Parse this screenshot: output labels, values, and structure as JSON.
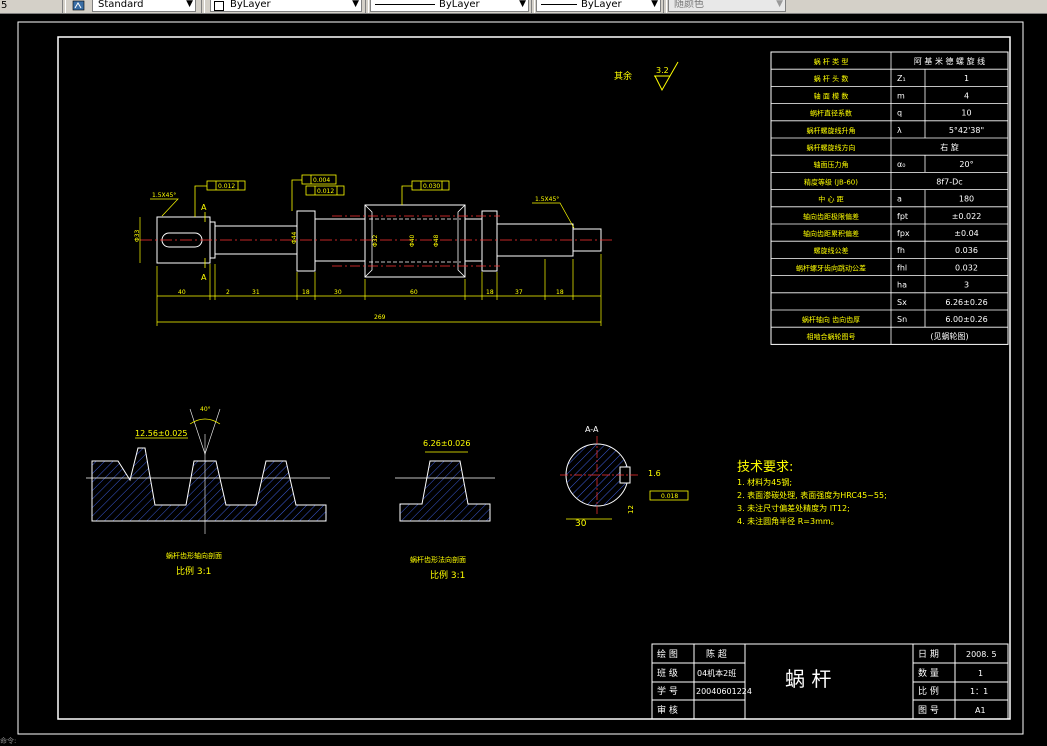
{
  "toolbar": {
    "left_value": "5",
    "text_style": "Standard",
    "layer": "ByLayer",
    "linetype": "ByLayer",
    "lineweight": "ByLayer",
    "color": "随颜色"
  },
  "title_block": {
    "part_name": "蜗   杆",
    "drawn_label": "绘  图",
    "drawn_value": "陈  超",
    "class_label": "班  级",
    "class_value": "04机本2班",
    "student_label": "学  号",
    "student_value": "20040601224",
    "review_label": "审  核",
    "date_label": "日  期",
    "date_value": "2008. 5",
    "qty_label": "数  量",
    "qty_value": "1",
    "scale_label": "比  例",
    "scale_value": "1：1",
    "drawing_no_label": "图  号",
    "drawing_no_value": "A1"
  },
  "param_table": {
    "rows": [
      {
        "label": "蜗  杆  类  型",
        "sym": "",
        "value": "阿  基  米  德  螺  旋  线"
      },
      {
        "label": "蜗  杆  头  数",
        "sym": "Z₁",
        "value": "1"
      },
      {
        "label": "轴  面  模  数",
        "sym": "m",
        "value": "4"
      },
      {
        "label": "蜗杆直径系数",
        "sym": "q",
        "value": "10"
      },
      {
        "label": "蜗杆螺旋线升角",
        "sym": "λ",
        "value": "5°42'38\""
      },
      {
        "label": "蜗杆螺旋线方向",
        "sym": "",
        "value": "右    旋"
      },
      {
        "label": "轴面压力角",
        "sym": "α₀",
        "value": "20°"
      },
      {
        "label": "精度等级  (JB-60)",
        "sym": "",
        "value": "8f7-Dc"
      },
      {
        "label": "中  心  距",
        "sym": "a",
        "value": "180"
      },
      {
        "label": "轴向齿距极限偏差",
        "sym": "fpt",
        "value": "±0.022"
      },
      {
        "label": "轴向齿距累积偏差",
        "sym": "fpx",
        "value": "±0.04"
      },
      {
        "label": "螺旋线公差",
        "sym": "fh",
        "value": "0.036"
      },
      {
        "label": "蜗杆螺牙齿向跳动公差",
        "sym": "fhl",
        "value": "0.032"
      },
      {
        "label": "",
        "sym": "ha",
        "value": "3"
      },
      {
        "label": "",
        "sym": "Sx",
        "value": "6.26±0.26"
      },
      {
        "label": "蜗杆轴向  齿向齿厚",
        "sym": "Sn",
        "value": "6.00±0.26"
      },
      {
        "label": "相啮合蜗轮图号",
        "sym": "",
        "value": "(见蜗轮图)"
      }
    ]
  },
  "notes": {
    "title": "技术要求:",
    "items": [
      "1. 材料为45钢;",
      "2. 表面渗碳处理, 表面强度为HRC45~55;",
      "3. 未注尺寸偏差处精度为 IT12;",
      "4. 未注圆角半径 R=3mm。"
    ]
  },
  "labels": {
    "roughness_note": "其余",
    "roughness_value": "3.2",
    "view1_title": "蜗杆齿形轴向剖面",
    "view1_scale": "比例  3:1",
    "view2_title": "蜗杆齿形法向剖面",
    "view2_scale": "比例  3:1",
    "section_label": "A-A",
    "tol1": "0.012",
    "tol2": "0.004",
    "tol3": "0.012",
    "tol4": "0.030",
    "tol5": "0.018",
    "chamfer_left": "1.5X45°",
    "chamfer_right": "1.5X45°",
    "dim_total": "269",
    "dim_40": "40",
    "dim_2": "2",
    "dim_31": "31",
    "dim_18a": "18",
    "dim_30": "30",
    "dim_60": "60",
    "dim_18b": "18",
    "dim_37": "37",
    "dim_18c": "18",
    "dim_12_56": "12.56±0.025",
    "dim_6_26": "6.26±0.026",
    "dim_40deg": "40°",
    "dim_30section": "30",
    "sec_dim": "1.6",
    "sec_dim2": "12"
  },
  "status_text": "命令:"
}
